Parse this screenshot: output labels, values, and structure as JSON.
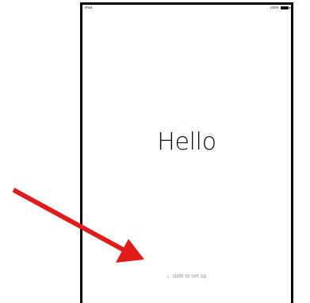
{
  "status_bar": {
    "carrier": "iPad",
    "battery_percent": "100%"
  },
  "greeting": "Hello",
  "slider": {
    "chevron": "›",
    "label": "slide to set up"
  },
  "colors": {
    "arrow": "#e01b1b",
    "frame": "#000000",
    "slider_text": "#9a9a9a"
  }
}
